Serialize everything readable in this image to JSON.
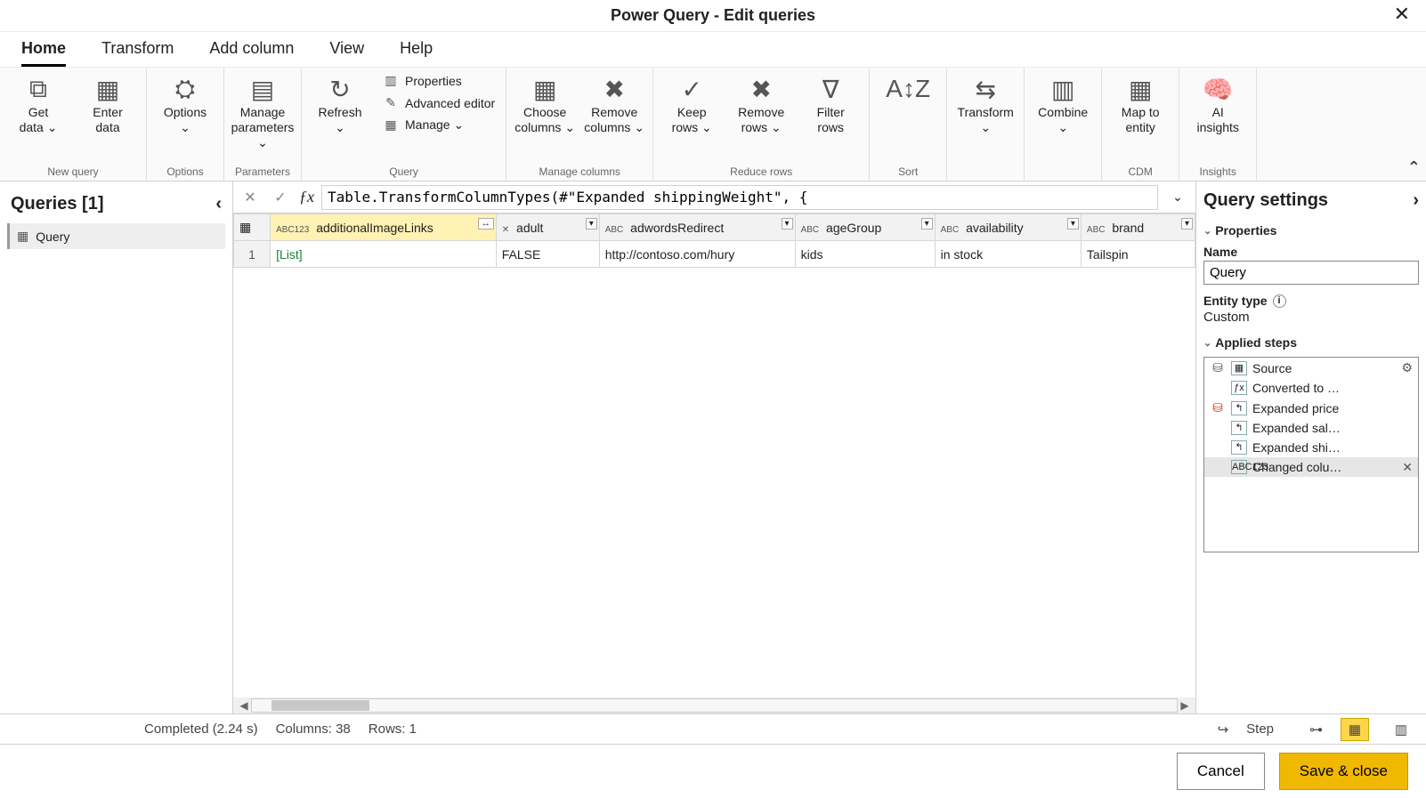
{
  "window": {
    "title": "Power Query - Edit queries"
  },
  "tabs": [
    "Home",
    "Transform",
    "Add column",
    "View",
    "Help"
  ],
  "ribbon": {
    "groups": [
      {
        "label": "New query",
        "big": [
          {
            "name": "get-data-button",
            "label": "Get\ndata ⌄",
            "icon": "⧉"
          },
          {
            "name": "enter-data-button",
            "label": "Enter\ndata",
            "icon": "▦"
          }
        ]
      },
      {
        "label": "Options",
        "big": [
          {
            "name": "options-button",
            "label": "Options\n⌄",
            "icon": "⛭"
          }
        ]
      },
      {
        "label": "Parameters",
        "big": [
          {
            "name": "manage-parameters-button",
            "label": "Manage\nparameters ⌄",
            "icon": "▤"
          }
        ]
      },
      {
        "label": "Query",
        "big": [
          {
            "name": "refresh-button",
            "label": "Refresh\n⌄",
            "icon": "↻"
          }
        ],
        "small": [
          {
            "name": "properties-button",
            "label": "Properties",
            "icon": "▥"
          },
          {
            "name": "advanced-editor-button",
            "label": "Advanced editor",
            "icon": "✎"
          },
          {
            "name": "manage-button",
            "label": "Manage ⌄",
            "icon": "▦"
          }
        ]
      },
      {
        "label": "Manage columns",
        "big": [
          {
            "name": "choose-columns-button",
            "label": "Choose\ncolumns ⌄",
            "icon": "▦"
          },
          {
            "name": "remove-columns-button",
            "label": "Remove\ncolumns ⌄",
            "icon": "✖"
          }
        ]
      },
      {
        "label": "Reduce rows",
        "big": [
          {
            "name": "keep-rows-button",
            "label": "Keep\nrows ⌄",
            "icon": "✓"
          },
          {
            "name": "remove-rows-button",
            "label": "Remove\nrows ⌄",
            "icon": "✖"
          },
          {
            "name": "filter-rows-button",
            "label": "Filter\nrows",
            "icon": "∇"
          }
        ]
      },
      {
        "label": "Sort",
        "big": [
          {
            "name": "sort-button",
            "label": "",
            "icon": "A↕Z"
          }
        ]
      },
      {
        "label": "",
        "big": [
          {
            "name": "transform-button",
            "label": "Transform\n⌄",
            "icon": "⇆"
          }
        ]
      },
      {
        "label": "",
        "big": [
          {
            "name": "combine-button",
            "label": "Combine\n⌄",
            "icon": "▥"
          }
        ]
      },
      {
        "label": "CDM",
        "big": [
          {
            "name": "map-to-entity-button",
            "label": "Map to\nentity",
            "icon": "▦"
          }
        ]
      },
      {
        "label": "Insights",
        "big": [
          {
            "name": "ai-insights-button",
            "label": "AI\ninsights",
            "icon": "🧠"
          }
        ]
      }
    ]
  },
  "queriesPane": {
    "title": "Queries [1]",
    "items": [
      {
        "label": "Query"
      }
    ]
  },
  "formula": "Table.TransformColumnTypes(#\"Expanded shippingWeight\", {",
  "grid": {
    "columns": [
      {
        "name": "additionalImageLinks",
        "type": "ABC123",
        "selected": true,
        "expand": true
      },
      {
        "name": "adult",
        "type": "✕"
      },
      {
        "name": "adwordsRedirect",
        "type": "ABC"
      },
      {
        "name": "ageGroup",
        "type": "ABC"
      },
      {
        "name": "availability",
        "type": "ABC"
      },
      {
        "name": "brand",
        "type": "ABC"
      }
    ],
    "rows": [
      {
        "n": "1",
        "cells": [
          "[List]",
          "FALSE",
          "http://contoso.com/hury",
          "kids",
          "in stock",
          "Tailspin"
        ]
      }
    ]
  },
  "settings": {
    "title": "Query settings",
    "properties_label": "Properties",
    "name_label": "Name",
    "name_value": "Query",
    "entity_type_label": "Entity type",
    "entity_type_value": "Custom",
    "applied_steps_label": "Applied steps",
    "steps": [
      {
        "label": "Source",
        "icon": "▦",
        "side": "db",
        "gear": true
      },
      {
        "label": "Converted to …",
        "icon": "ƒx",
        "side": ""
      },
      {
        "label": "Expanded price",
        "icon": "↰",
        "side": "db-red"
      },
      {
        "label": "Expanded sal…",
        "icon": "↰",
        "side": ""
      },
      {
        "label": "Expanded shi…",
        "icon": "↰",
        "side": ""
      },
      {
        "label": "Changed colu…",
        "icon": "ABC123",
        "side": "",
        "selected": true,
        "del": true
      }
    ]
  },
  "status": {
    "completed": "Completed (2.24 s)",
    "columns": "Columns: 38",
    "rows": "Rows: 1",
    "step_label": "Step"
  },
  "footer": {
    "cancel": "Cancel",
    "save": "Save & close"
  }
}
